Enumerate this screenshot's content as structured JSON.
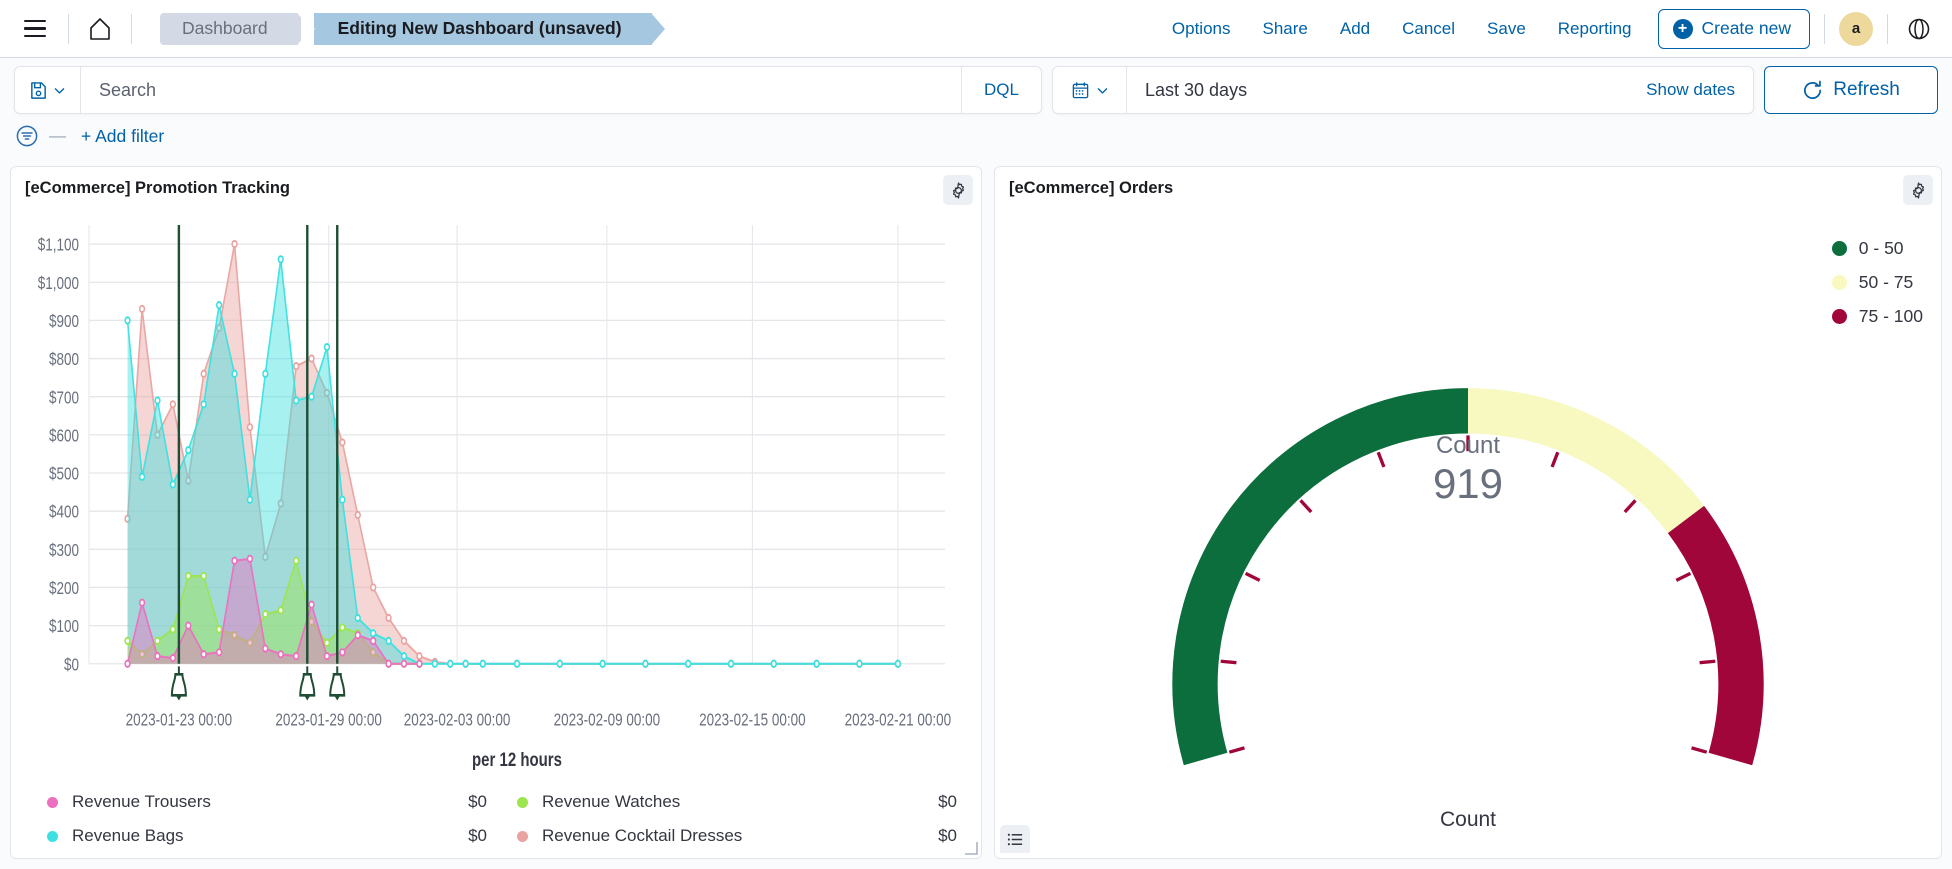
{
  "topnav": {
    "menu_icon": "hamburger-menu-icon",
    "home_icon": "home-icon",
    "breadcrumbs": [
      {
        "label": "Dashboard",
        "active": false
      },
      {
        "label": "Editing New Dashboard (unsaved)",
        "active": true
      }
    ],
    "links": [
      "Options",
      "Share",
      "Add",
      "Cancel",
      "Save",
      "Reporting"
    ],
    "create_new_label": "Create new",
    "avatar_initial": "a",
    "help_icon": "help-circle-icon"
  },
  "querybar": {
    "saved_query_icon": "save-disk-icon",
    "chevron_icon": "chevron-down-icon",
    "search_placeholder": "Search",
    "search_value": "",
    "language_badge": "DQL",
    "calendar_icon": "calendar-icon",
    "date_range": "Last 30 days",
    "show_dates_label": "Show dates",
    "refresh_label": "Refresh",
    "refresh_icon": "refresh-icon"
  },
  "filterbar": {
    "filter_icon": "filter-circle-icon",
    "dash": "—",
    "add_filter_label": "+ Add filter"
  },
  "panels": {
    "promotion": {
      "title": "[eCommerce] Promotion Tracking",
      "gear_icon": "gear-icon",
      "resize_icon": "resize-handle-icon",
      "legend": [
        {
          "label": "Revenue Trousers",
          "value": "$0",
          "color": "#ed6fc0"
        },
        {
          "label": "Revenue Watches",
          "value": "$0",
          "color": "#9ce54f"
        },
        {
          "label": "Revenue Bags",
          "value": "$0",
          "color": "#3ce0e0"
        },
        {
          "label": "Revenue Cocktail Dresses",
          "value": "$0",
          "color": "#e9a3a0"
        }
      ]
    },
    "orders": {
      "title": "[eCommerce] Orders",
      "gear_icon": "gear-icon",
      "legend_toggle_icon": "list-legend-icon",
      "legend": [
        {
          "label": "0 - 50",
          "color": "#0c6e3c"
        },
        {
          "label": "50 - 75",
          "color": "#f7f9c0"
        },
        {
          "label": "75 - 100",
          "color": "#a1063a"
        }
      ],
      "metric_label": "Count",
      "metric_value": "919",
      "footer_label": "Count"
    }
  },
  "chart_data": [
    {
      "type": "area",
      "title": "[eCommerce] Promotion Tracking",
      "xlabel": "per 12 hours",
      "ylabel": "",
      "ylim": [
        0,
        1150
      ],
      "grid": true,
      "legend_position": "bottom",
      "yticks": [
        "$0",
        "$100",
        "$200",
        "$300",
        "$400",
        "$500",
        "$600",
        "$700",
        "$800",
        "$900",
        "$1,000",
        "$1,100"
      ],
      "ytick_values": [
        0,
        100,
        200,
        300,
        400,
        500,
        600,
        700,
        800,
        900,
        1000,
        1100
      ],
      "xticks": [
        "2023-01-23 00:00",
        "2023-01-29 00:00",
        "2023-02-03 00:00",
        "2023-02-09 00:00",
        "2023-02-15 00:00",
        "2023-02-21 00:00"
      ],
      "xtick_positions": [
        0.105,
        0.28,
        0.43,
        0.605,
        0.775,
        0.945
      ],
      "annotations": [
        {
          "x": 0.105,
          "icon": "bell-annotation-icon",
          "color": "#1f4e35"
        },
        {
          "x": 0.255,
          "icon": "bell-annotation-icon",
          "color": "#1f4e35"
        },
        {
          "x": 0.29,
          "icon": "bell-annotation-icon",
          "color": "#1f4e35"
        }
      ],
      "series": [
        {
          "name": "Revenue Cocktail Dresses",
          "color": "#e9a3a0",
          "x": [
            0.045,
            0.062,
            0.08,
            0.098,
            0.116,
            0.134,
            0.152,
            0.17,
            0.188,
            0.206,
            0.224,
            0.242,
            0.26,
            0.278,
            0.296,
            0.314,
            0.332,
            0.35,
            0.368,
            0.386,
            0.404,
            0.422,
            0.44,
            0.46,
            0.5,
            0.55,
            0.6,
            0.65,
            0.7,
            0.75,
            0.8,
            0.85,
            0.9,
            0.945
          ],
          "y": [
            380,
            930,
            600,
            680,
            480,
            760,
            880,
            1100,
            620,
            280,
            420,
            780,
            800,
            710,
            580,
            390,
            200,
            120,
            60,
            20,
            5,
            0,
            0,
            0,
            0,
            0,
            0,
            0,
            0,
            0,
            0,
            0,
            0,
            0
          ]
        },
        {
          "name": "Revenue Bags",
          "color": "#3ce0e0",
          "x": [
            0.045,
            0.062,
            0.08,
            0.098,
            0.116,
            0.134,
            0.152,
            0.17,
            0.188,
            0.206,
            0.224,
            0.242,
            0.26,
            0.278,
            0.296,
            0.314,
            0.332,
            0.35,
            0.368,
            0.386,
            0.404,
            0.422,
            0.44,
            0.46,
            0.5,
            0.55,
            0.6,
            0.65,
            0.7,
            0.75,
            0.8,
            0.85,
            0.9,
            0.945
          ],
          "y": [
            900,
            490,
            690,
            470,
            560,
            680,
            940,
            760,
            430,
            760,
            1060,
            690,
            700,
            830,
            430,
            120,
            80,
            60,
            20,
            0,
            0,
            0,
            0,
            0,
            0,
            0,
            0,
            0,
            0,
            0,
            0,
            0,
            0,
            0
          ]
        },
        {
          "name": "Revenue Watches",
          "color": "#9ce54f",
          "x": [
            0.045,
            0.062,
            0.08,
            0.098,
            0.116,
            0.134,
            0.152,
            0.17,
            0.188,
            0.206,
            0.224,
            0.242,
            0.26,
            0.278,
            0.296,
            0.314,
            0.332,
            0.35,
            0.368,
            0.386
          ],
          "y": [
            60,
            25,
            60,
            90,
            230,
            230,
            90,
            75,
            55,
            130,
            140,
            270,
            110,
            55,
            95,
            80,
            30,
            0,
            0,
            0
          ]
        },
        {
          "name": "Revenue Trousers",
          "color": "#ed6fc0",
          "x": [
            0.045,
            0.062,
            0.08,
            0.098,
            0.116,
            0.134,
            0.152,
            0.17,
            0.188,
            0.206,
            0.224,
            0.242,
            0.26,
            0.278,
            0.296,
            0.314,
            0.332,
            0.35,
            0.368,
            0.386
          ],
          "y": [
            0,
            160,
            20,
            15,
            100,
            25,
            30,
            270,
            275,
            40,
            25,
            20,
            155,
            20,
            30,
            75,
            60,
            0,
            0,
            0
          ]
        }
      ]
    },
    {
      "type": "gauge",
      "title": "[eCommerce] Orders",
      "metric_label": "Count",
      "value": 919,
      "min": 0,
      "max": 100,
      "bands": [
        {
          "label": "0 - 50",
          "from": 0,
          "to": 50,
          "color": "#0c6e3c"
        },
        {
          "label": "50 - 75",
          "from": 50,
          "to": 75,
          "color": "#f7f9c0"
        },
        {
          "label": "75 - 100",
          "from": 75,
          "to": 100,
          "color": "#a1063a"
        }
      ],
      "ticks": 10,
      "legend_position": "top-right"
    }
  ]
}
